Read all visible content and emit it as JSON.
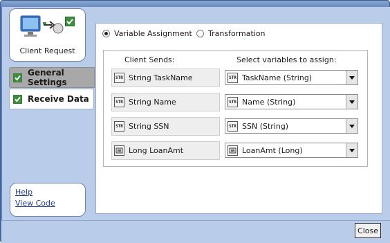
{
  "client_card": {
    "label": "Client Request"
  },
  "nav": [
    {
      "label": "General Settings"
    },
    {
      "label": "Receive Data"
    }
  ],
  "links": {
    "help": "Help",
    "view_code": "View Code"
  },
  "mode": {
    "variable_assignment": "Variable Assignment",
    "transformation": "Transformation",
    "selected": "variable_assignment"
  },
  "headers": {
    "client_sends": "Client Sends:",
    "select_vars": "Select variables to assign:"
  },
  "rows": [
    {
      "icon": "string-type-icon",
      "sends": "String TaskName",
      "selected": "TaskName (String)"
    },
    {
      "icon": "string-type-icon",
      "sends": "String Name",
      "selected": "Name (String)"
    },
    {
      "icon": "string-type-icon",
      "sends": "String SSN",
      "selected": "SSN (String)"
    },
    {
      "icon": "long-type-icon",
      "sends": "Long LoanAmt",
      "selected": "LoanAmt (Long)"
    }
  ],
  "close_label": "Close"
}
